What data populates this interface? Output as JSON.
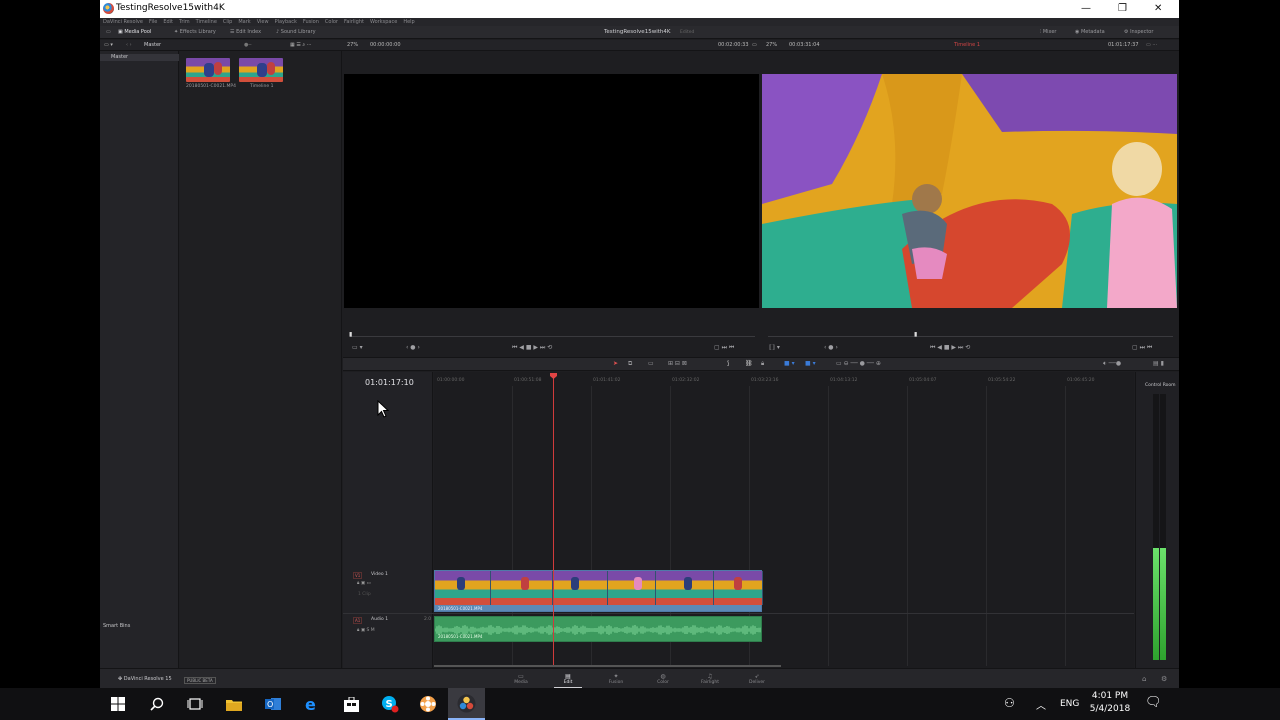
{
  "window": {
    "title": "TestingResolve15with4K",
    "minimize": "—",
    "maximize": "❐",
    "close": "✕"
  },
  "menu": [
    "DaVinci Resolve",
    "File",
    "Edit",
    "Trim",
    "Timeline",
    "Clip",
    "Mark",
    "View",
    "Playback",
    "Fusion",
    "Color",
    "Fairlight",
    "Workspace",
    "Help"
  ],
  "toolbar": {
    "media_pool": "Media Pool",
    "effects_library": "Effects Library",
    "edit_index": "Edit Index",
    "sound_library": "Sound Library",
    "project_name": "TestingResolve15with4K",
    "project_status": "Edited",
    "mixer": "Mixer",
    "metadata": "Metadata",
    "inspector": "Inspector"
  },
  "subbar": {
    "bin_label": "Master",
    "src_zoom": "27%",
    "src_tc": "00:00:00:00",
    "src_duration": "00:02:00:33",
    "tl_zoom": "27%",
    "tl_duration": "00:03:31:04",
    "timeline_name": "Timeline 1",
    "tl_tc": "01:01:17:37"
  },
  "bins": {
    "master": "Master",
    "smart_bins": "Smart Bins"
  },
  "media_pool": {
    "clips": [
      {
        "name": "20180501-C0021.MP4"
      },
      {
        "name": "Timeline 1"
      }
    ]
  },
  "timeline": {
    "timecode": "01:01:17:10",
    "ruler_ticks": [
      "01:00:00:00",
      "01:00:51:08",
      "01:01:41:02",
      "01:02:32:02",
      "01:03:23:16",
      "01:04:13:12",
      "01:05:04:07",
      "01:05:54:22",
      "01:06:45:20"
    ],
    "video_track": {
      "badge": "V1",
      "name": "Video 1",
      "clips_label": "1 Clip"
    },
    "audio_track": {
      "badge": "A1",
      "name": "Audio 1",
      "level": "2.0"
    },
    "video_clip_name": "20180501-C0021.MP4",
    "audio_clip_name": "20180501-C0021.MP4"
  },
  "meters": {
    "label": "Control Room",
    "level": 0.42
  },
  "app_footer": {
    "app_name": "DaVinci Resolve 15",
    "beta": "PUBLIC BETA"
  },
  "pages": [
    {
      "label": "Media",
      "icon": "▭"
    },
    {
      "label": "Edit",
      "icon": "▤"
    },
    {
      "label": "Fusion",
      "icon": "✦"
    },
    {
      "label": "Color",
      "icon": "◍"
    },
    {
      "label": "Fairlight",
      "icon": "♫"
    },
    {
      "label": "Deliver",
      "icon": "➶"
    }
  ],
  "taskbar": {
    "lang": "ENG",
    "time": "4:01 PM",
    "date": "5/4/2018"
  }
}
